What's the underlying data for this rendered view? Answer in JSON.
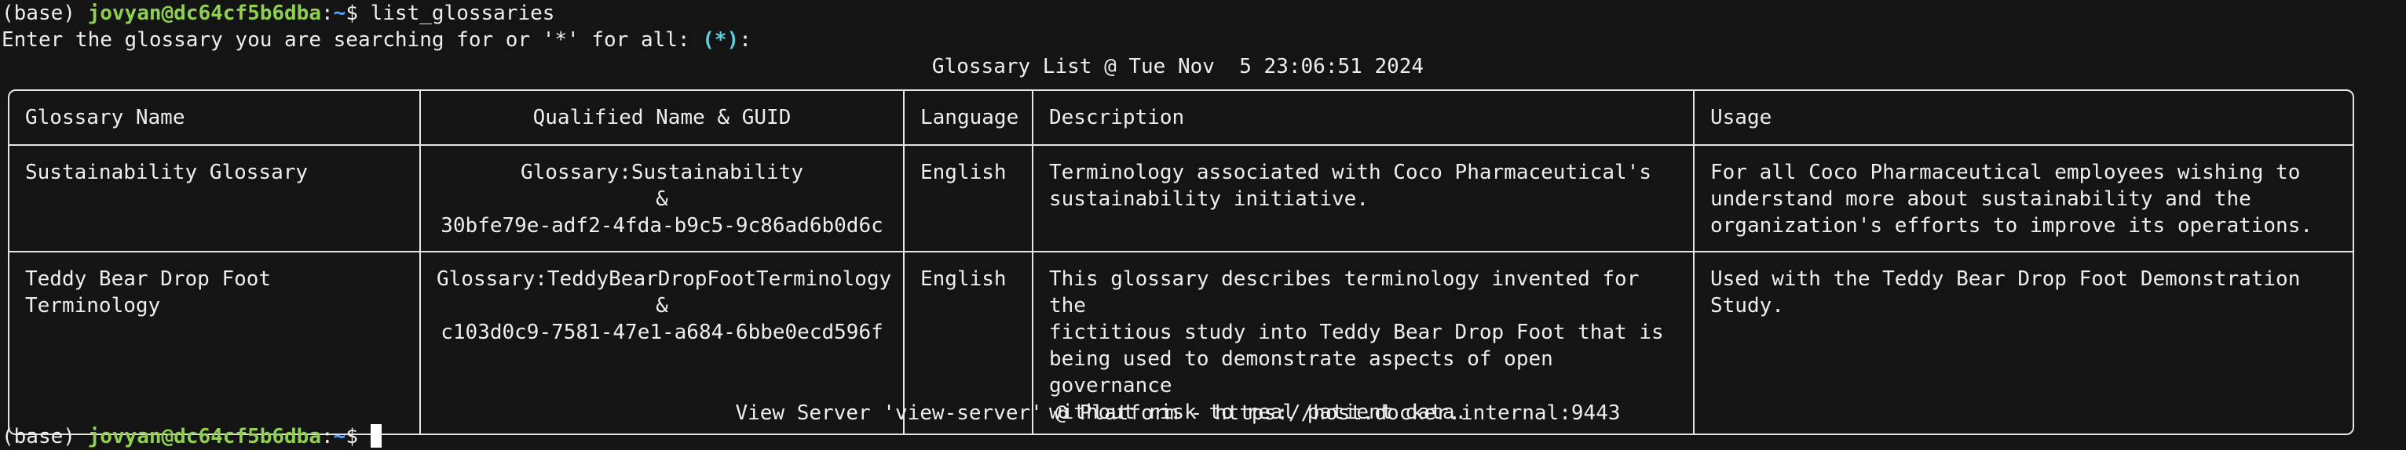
{
  "terminal": {
    "line1": {
      "env": "(base) ",
      "user_host": "jovyan@dc64cf5b6dba",
      "colon": ":",
      "path": "~",
      "symbol": "$ ",
      "command": "list_glossaries"
    },
    "line2": {
      "text": "Enter the glossary you are searching for or '*' for all: ",
      "default": "(*)",
      "suffix": ":"
    },
    "table_title": "Glossary List @ Tue Nov  5 23:06:51 2024",
    "footer": "View Server 'view-server' @ Platform - https://host.docker.internal:9443",
    "next_prompt": {
      "env": "(base) ",
      "user_host": "jovyan@dc64cf5b6dba",
      "colon": ":",
      "path": "~",
      "symbol": "$ "
    }
  },
  "table": {
    "headers": [
      "Glossary Name",
      "Qualified Name & GUID",
      "Language",
      "Description",
      "Usage"
    ],
    "rows": [
      {
        "name": "Sustainability Glossary",
        "qualified": "Glossary:Sustainability\n&\n30bfe79e-adf2-4fda-b9c5-9c86ad6b0d6c",
        "language": "English",
        "description": "Terminology associated with Coco Pharmaceutical's\nsustainability initiative.",
        "usage": "For all Coco Pharmaceutical employees wishing to\nunderstand more about sustainability and the\norganization's efforts to improve its operations."
      },
      {
        "name": "Teddy Bear Drop Foot Terminology",
        "qualified": "Glossary:TeddyBearDropFootTerminology\n&\nc103d0c9-7581-47e1-a684-6bbe0ecd596f",
        "language": "English",
        "description": "This glossary describes terminology invented for the\nfictitious study into Teddy Bear Drop Foot that is\nbeing used to demonstrate aspects of open governance\nwithout risk to real patient data.",
        "usage": "Used with the Teddy Bear Drop Foot Demonstration\nStudy."
      }
    ]
  }
}
